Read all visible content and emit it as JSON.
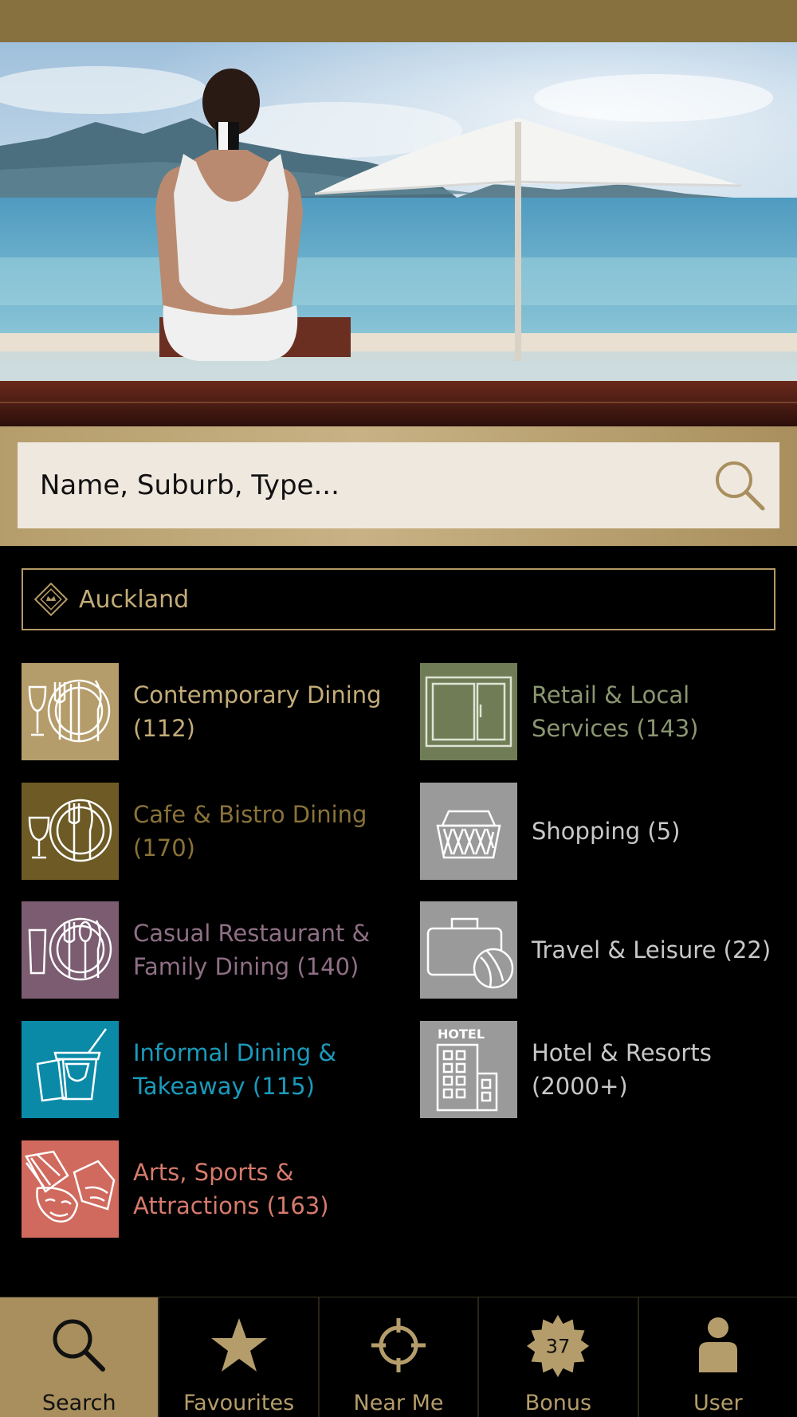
{
  "search": {
    "placeholder": "Name, Suburb, Type..."
  },
  "region": {
    "label": "Auckland",
    "icon": "diamond-crown-icon"
  },
  "categories": [
    {
      "label": "Contemporary Dining (112)",
      "icon": "wine-glass-plate-cutlery-icon",
      "tile_color": "#b59d6b",
      "text_color": "#c4ac78"
    },
    {
      "label": "Retail & Local Services (143)",
      "icon": "shop-window-icon",
      "tile_color": "#6f7c55",
      "text_color": "#8a9670"
    },
    {
      "label": "Cafe & Bistro Dining (170)",
      "icon": "wine-glass-plate-cutlery-icon",
      "tile_color": "#6d5a25",
      "text_color": "#8a7338"
    },
    {
      "label": "Shopping (5)",
      "icon": "basket-icon",
      "tile_color": "#9a9a9a",
      "text_color": "#c8c8c8"
    },
    {
      "label": "Casual Restaurant & Family Dining (140)",
      "icon": "glass-plate-cutlery-icon",
      "tile_color": "#7b5c70",
      "text_color": "#8f6f85"
    },
    {
      "label": "Travel & Leisure (22)",
      "icon": "suitcase-ball-icon",
      "tile_color": "#9a9a9a",
      "text_color": "#c8c8c8"
    },
    {
      "label": "Informal Dining & Takeaway (115)",
      "icon": "takeaway-cups-icon",
      "tile_color": "#0b8aa8",
      "text_color": "#1a9bbb"
    },
    {
      "label": "Hotel & Resorts (2000+)",
      "icon": "hotel-building-icon",
      "tile_color": "#9a9a9a",
      "text_color": "#c8c8c8",
      "tile_text": "HOTEL"
    },
    {
      "label": "Arts, Sports & Attractions (163)",
      "icon": "theatre-masks-icon",
      "tile_color": "#d06a5e",
      "text_color": "#d67a6c"
    }
  ],
  "nav": [
    {
      "label": "Search",
      "icon": "search-icon",
      "active": true
    },
    {
      "label": "Favourites",
      "icon": "star-icon",
      "active": false
    },
    {
      "label": "Near Me",
      "icon": "crosshair-icon",
      "active": false
    },
    {
      "label": "Bonus",
      "icon": "badge-icon",
      "active": false,
      "badge_value": "37"
    },
    {
      "label": "User",
      "icon": "user-icon",
      "active": false
    }
  ],
  "colors": {
    "gold": "#b59d6b",
    "top_bar": "#86713f",
    "active_tab": "#a88f5d"
  }
}
